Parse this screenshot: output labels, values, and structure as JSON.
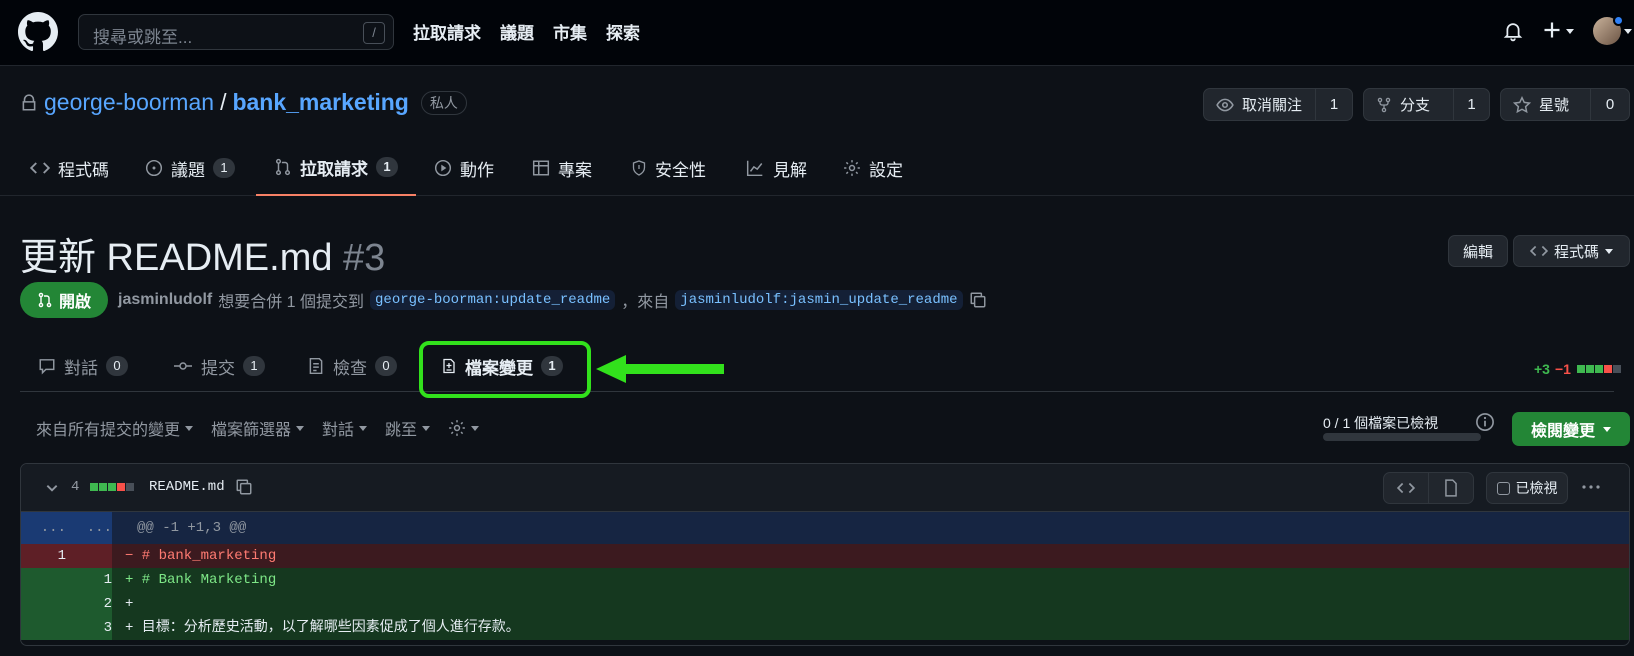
{
  "header": {
    "search_placeholder": "搜尋或跳至...",
    "search_shortcut": "/",
    "nav": [
      "拉取請求",
      "議題",
      "市集",
      "探索"
    ]
  },
  "repo": {
    "owner": "george-boorman",
    "separator": "/",
    "name": "bank_marketing",
    "visibility": "私人",
    "watch": {
      "label": "取消關注",
      "count": "1"
    },
    "fork": {
      "label": "分支",
      "count": "1"
    },
    "star": {
      "label": "星號",
      "count": "0"
    },
    "tabs": [
      {
        "label": "程式碼",
        "icon": "code-icon"
      },
      {
        "label": "議題",
        "icon": "issue-icon",
        "count": "1"
      },
      {
        "label": "拉取請求",
        "icon": "pull-request-icon",
        "count": "1",
        "active": true
      },
      {
        "label": "動作",
        "icon": "play-icon"
      },
      {
        "label": "專案",
        "icon": "table-icon"
      },
      {
        "label": "安全性",
        "icon": "shield-icon"
      },
      {
        "label": "見解",
        "icon": "graph-icon"
      },
      {
        "label": "設定",
        "icon": "gear-icon"
      }
    ]
  },
  "pr": {
    "title": "更新 README.md",
    "number": "#3",
    "edit_label": "編輯",
    "code_label": "程式碼",
    "state": "開啟",
    "author": "jasminludolf",
    "action_text": "想要合併 1 個提交到",
    "base_branch": "george-boorman:update_readme",
    "from_text": "，來自",
    "head_branch": "jasminludolf:jasmin_update_readme",
    "tabs": [
      {
        "label": "對話",
        "count": "0",
        "icon": "comment-icon"
      },
      {
        "label": "提交",
        "count": "1",
        "icon": "commit-icon"
      },
      {
        "label": "檢查",
        "count": "0",
        "icon": "checklist-icon"
      },
      {
        "label": "檔案變更",
        "count": "1",
        "icon": "file-diff-icon",
        "active": true
      }
    ],
    "diffstat": {
      "additions": "+3",
      "deletions": "−1"
    }
  },
  "toolbar": {
    "commits_filter": "來自所有提交的變更",
    "file_filter": "檔案篩選器",
    "conversations": "對話",
    "jump_to": "跳至",
    "viewed_progress": "0 / 1 個檔案已檢視",
    "review_button": "檢閱變更"
  },
  "file": {
    "change_count": "4",
    "name": "README.md",
    "viewed_label": "已檢視",
    "hunk_old": "...",
    "hunk_new": "...",
    "hunk_header": "@@ -1 +1,3 @@",
    "lines": [
      {
        "type": "del",
        "old": "1",
        "new": "",
        "text": "− # bank_marketing"
      },
      {
        "type": "add",
        "old": "",
        "new": "1",
        "text": "+ # Bank Marketing"
      },
      {
        "type": "add",
        "old": "",
        "new": "2",
        "text": "+"
      },
      {
        "type": "add",
        "old": "",
        "new": "3",
        "text": "+ 目標：分析歷史活動，以了解哪些因素促成了個人進行存款。"
      }
    ]
  },
  "colors": {
    "accent": "#58a6ff",
    "open_green": "#238636",
    "highlight": "#32e11c",
    "del_bg": "#3c1a1f",
    "add_bg": "#15381f"
  }
}
